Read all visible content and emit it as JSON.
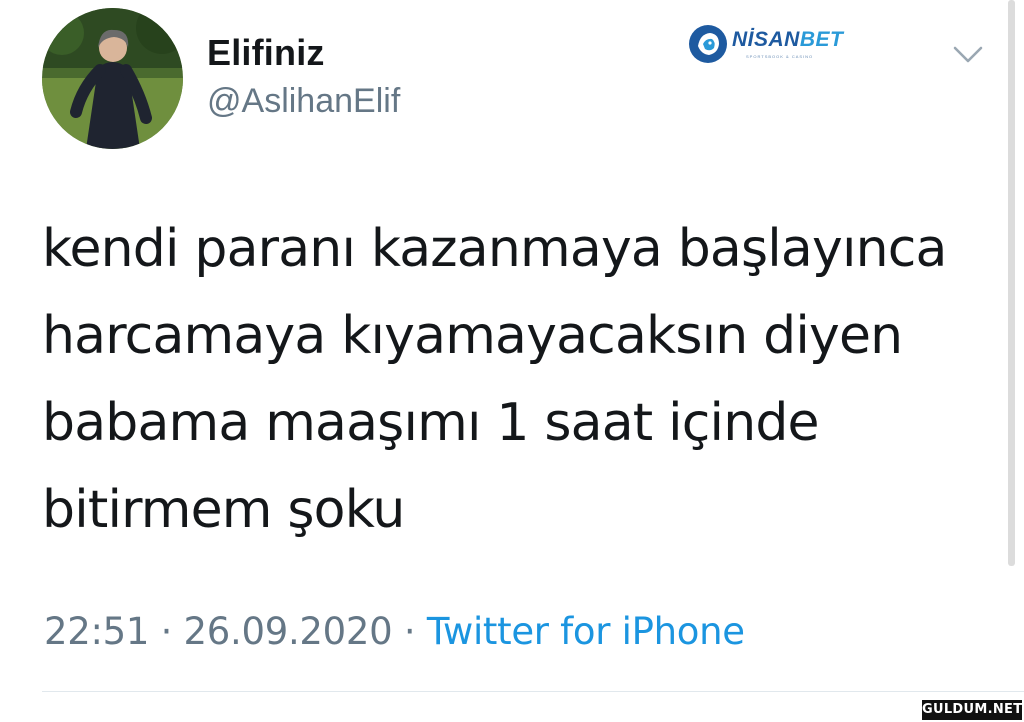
{
  "tweet": {
    "author": {
      "display_name": "Elifiniz",
      "handle": "@AslihanElif",
      "avatar_icon": "profile-photo"
    },
    "text_lines": [
      "kendi paranı kazanmaya başlayınca",
      "harcamaya kıyamayacaksın diyen",
      "babama maaşımı 1 saat içinde",
      "bitirmem şoku"
    ],
    "time": "22:51",
    "separator": "·",
    "date": "26.09.2020",
    "source": "Twitter for iPhone",
    "menu_icon": "chevron-down-icon"
  },
  "overlay": {
    "brand_prefix": "NİSAN",
    "brand_suffix": "BET",
    "brand_tagline": "SPORTSBOOK & CASINO",
    "watermark": "GULDUM.NET"
  },
  "colors": {
    "text_primary": "#14171a",
    "text_secondary": "#657786",
    "link": "#1b95e0",
    "divider": "#e1e8ed",
    "brand_dark": "#1e5aa0",
    "brand_light": "#2a9ad8"
  }
}
